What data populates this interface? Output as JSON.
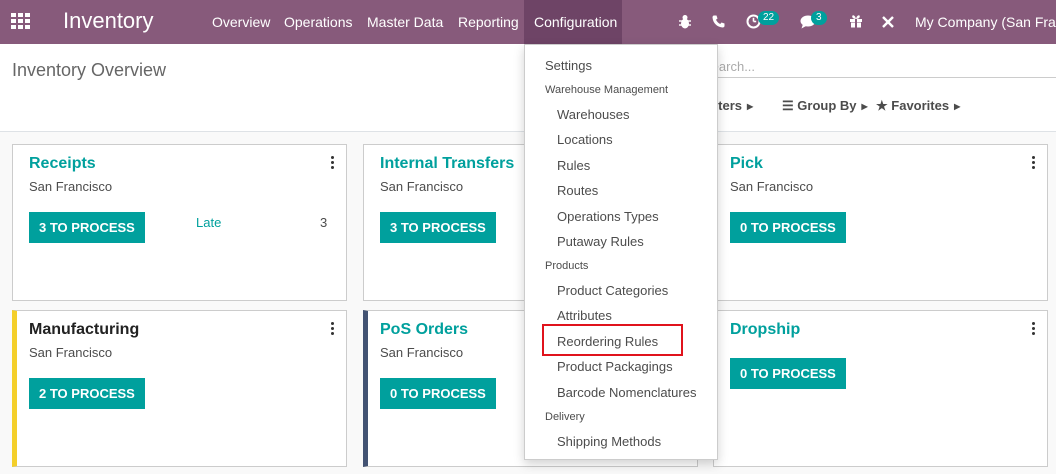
{
  "navbar": {
    "app_title": "Inventory",
    "menu": [
      "Overview",
      "Operations",
      "Master Data",
      "Reporting",
      "Configuration"
    ],
    "badges": {
      "activity": "22",
      "messages": "3"
    },
    "company": "My Company (San Francisco)",
    "bg_color": "#875a7b"
  },
  "control_panel": {
    "title": "Inventory Overview",
    "search_placeholder": "Search...",
    "filters": "Filters",
    "group_by": "Group By",
    "favorites": "Favorites"
  },
  "cards": [
    {
      "title": "Receipts",
      "subtitle": "San Francisco",
      "button": "3 TO PROCESS",
      "late_label": "Late",
      "late_count": "3"
    },
    {
      "title": "Internal Transfers",
      "subtitle": "San Francisco",
      "button": "3 TO PROCESS"
    },
    {
      "title": "Pick",
      "subtitle": "San Francisco",
      "button": "0 TO PROCESS"
    },
    {
      "title": "Manufacturing",
      "subtitle": "San Francisco",
      "button": "2 TO PROCESS"
    },
    {
      "title": "PoS Orders",
      "subtitle": "San Francisco",
      "button": "0 TO PROCESS"
    },
    {
      "title": "Dropship",
      "subtitle": "",
      "button": "0 TO PROCESS"
    }
  ],
  "dropdown": {
    "settings": "Settings",
    "warehouse_header": "Warehouse Management",
    "warehouse_items": [
      "Warehouses",
      "Locations",
      "Rules",
      "Routes",
      "Operations Types",
      "Putaway Rules"
    ],
    "products_header": "Products",
    "product_items": [
      "Product Categories",
      "Attributes",
      "Reordering Rules",
      "Product Packagings",
      "Barcode Nomenclatures"
    ],
    "delivery_header": "Delivery",
    "delivery_items": [
      "Shipping Methods"
    ],
    "highlighted_item": "Reordering Rules"
  },
  "colors": {
    "primary": "#00a09d",
    "highlight": "#e0131c",
    "accent_yellow": "#f4cf2a",
    "accent_navy": "#435373"
  }
}
